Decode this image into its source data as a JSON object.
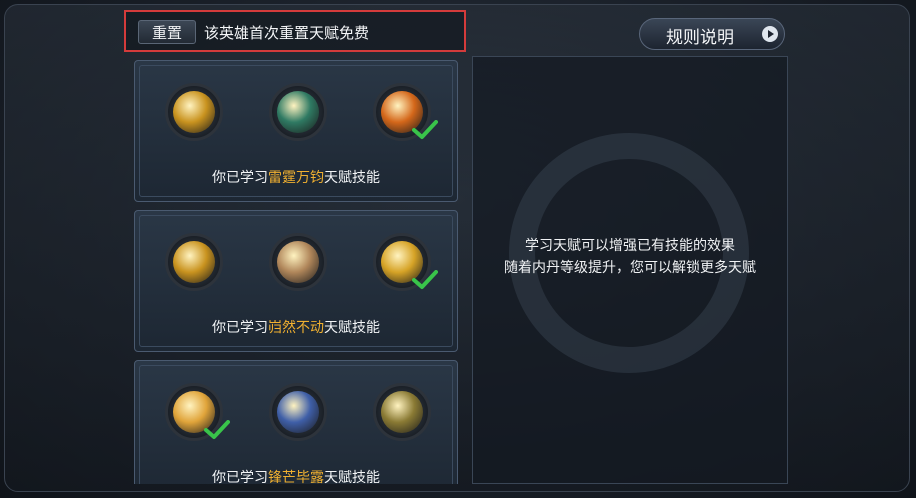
{
  "header": {
    "reset_button": "重置",
    "reset_notice": "该英雄首次重置天赋免费",
    "rules_button": "规则说明"
  },
  "talent_rows": [
    {
      "label_prefix": "你已学习",
      "label_highlight": "雷霆万钧",
      "label_suffix": "天赋技能",
      "icons": [
        {
          "name": "golden-fist-talent-icon",
          "color": "#c9931f",
          "learned": false
        },
        {
          "name": "green-wind-talent-icon",
          "color": "#2f7a63",
          "learned": false
        },
        {
          "name": "fire-warrior-talent-icon",
          "color": "#d4671a",
          "learned": true
        }
      ]
    },
    {
      "label_prefix": "你已学习",
      "label_highlight": "岿然不动",
      "label_suffix": "天赋技能",
      "icons": [
        {
          "name": "golden-fist-talent-icon",
          "color": "#c9931f",
          "learned": false
        },
        {
          "name": "blade-slash-talent-icon",
          "color": "#b0865a",
          "learned": false
        },
        {
          "name": "golden-shield-talent-icon",
          "color": "#d6a326",
          "learned": true
        }
      ]
    },
    {
      "label_prefix": "你已学习",
      "label_highlight": "锋芒毕露",
      "label_suffix": "天赋技能",
      "icons": [
        {
          "name": "sword-burst-talent-icon",
          "color": "#e0a43a",
          "learned": true
        },
        {
          "name": "red-phoenix-talent-icon",
          "color": "#3f5fa8",
          "learned": false
        },
        {
          "name": "earth-strike-talent-icon",
          "color": "#8a7a34",
          "learned": false
        }
      ]
    }
  ],
  "description": {
    "line1": "学习天赋可以增强已有技能的效果",
    "line2": "随着内丹等级提升，您可以解锁更多天赋"
  },
  "colors": {
    "highlight": "#f0b030",
    "check": "#39c44a",
    "red_outline": "#d43b3b"
  }
}
